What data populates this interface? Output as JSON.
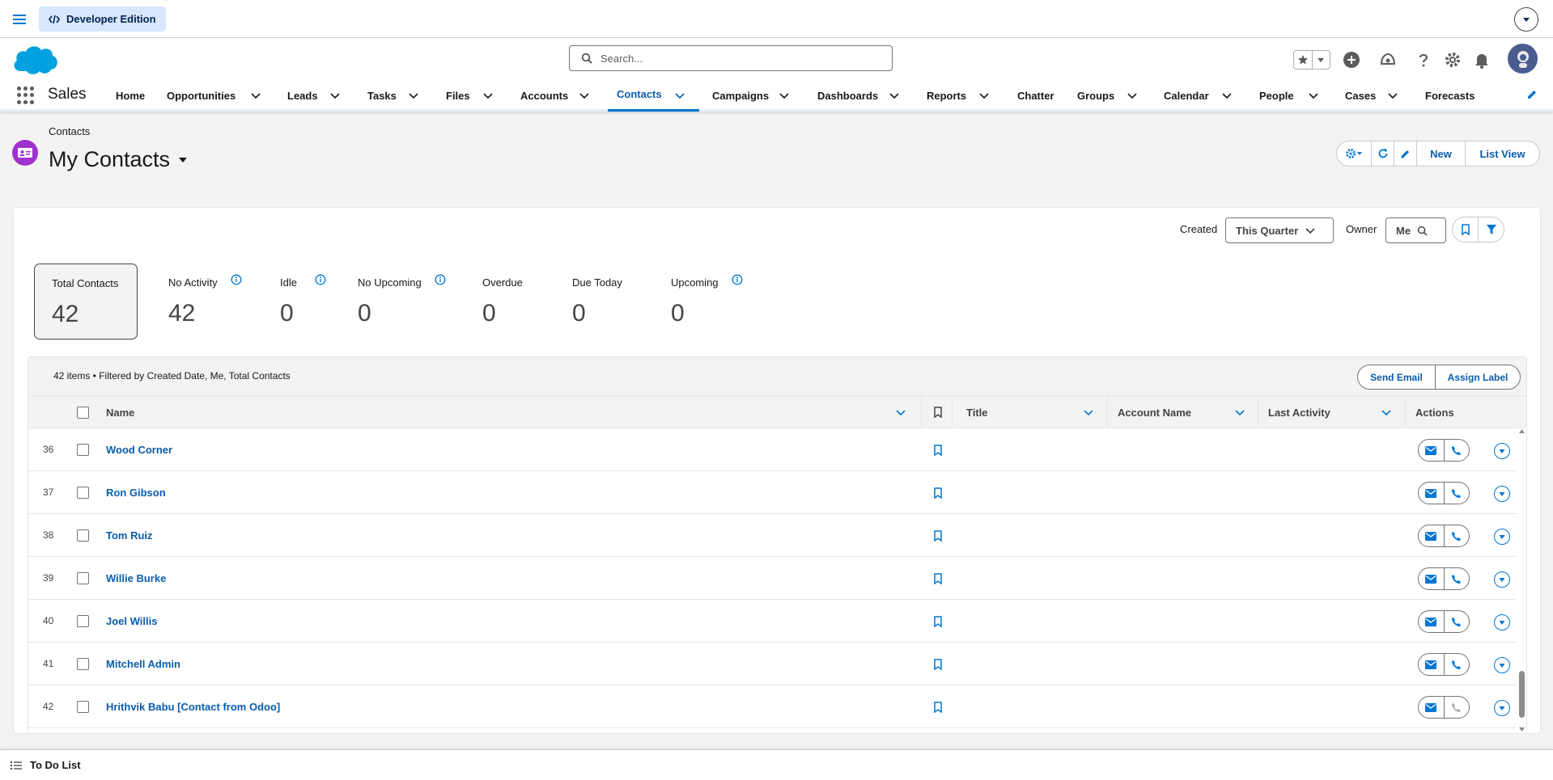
{
  "devbar": {
    "edition_label": "Developer Edition"
  },
  "header": {
    "search_placeholder": "Search..."
  },
  "nav": {
    "app_name": "Sales",
    "items": [
      {
        "label": "Home"
      },
      {
        "label": "Opportunities"
      },
      {
        "label": "Leads"
      },
      {
        "label": "Tasks"
      },
      {
        "label": "Files"
      },
      {
        "label": "Accounts"
      },
      {
        "label": "Contacts"
      },
      {
        "label": "Campaigns"
      },
      {
        "label": "Dashboards"
      },
      {
        "label": "Reports"
      },
      {
        "label": "Chatter"
      },
      {
        "label": "Groups"
      },
      {
        "label": "Calendar"
      },
      {
        "label": "People"
      },
      {
        "label": "Cases"
      },
      {
        "label": "Forecasts"
      }
    ],
    "active": "Contacts"
  },
  "page": {
    "breadcrumb": "Contacts",
    "title": "My Contacts",
    "buttons": {
      "new": "New",
      "list_view": "List View"
    }
  },
  "filters": {
    "created_label": "Created",
    "created_value": "This Quarter",
    "owner_label": "Owner",
    "owner_value": "Me"
  },
  "metrics": [
    {
      "label": "Total Contacts",
      "value": "42",
      "selected": true
    },
    {
      "label": "No Activity",
      "value": "42"
    },
    {
      "label": "Idle",
      "value": "0"
    },
    {
      "label": "No Upcoming",
      "value": "0"
    },
    {
      "label": "Overdue",
      "value": "0"
    },
    {
      "label": "Due Today",
      "value": "0"
    },
    {
      "label": "Upcoming",
      "value": "0"
    }
  ],
  "list": {
    "summary": "42 items • Filtered by Created Date, Me, Total Contacts",
    "send_email": "Send Email",
    "assign_label": "Assign Label",
    "columns": {
      "name": "Name",
      "title": "Title",
      "account": "Account Name",
      "last_activity": "Last Activity",
      "actions": "Actions"
    },
    "rows": [
      {
        "num": "36",
        "name": "Wood Corner"
      },
      {
        "num": "37",
        "name": "Ron Gibson"
      },
      {
        "num": "38",
        "name": "Tom Ruiz"
      },
      {
        "num": "39",
        "name": "Willie Burke"
      },
      {
        "num": "40",
        "name": "Joel Willis"
      },
      {
        "num": "41",
        "name": "Mitchell Admin"
      },
      {
        "num": "42",
        "name": "Hrithvik Babu [Contact from Odoo]"
      }
    ]
  },
  "utility": {
    "todo_label": "To Do List"
  }
}
